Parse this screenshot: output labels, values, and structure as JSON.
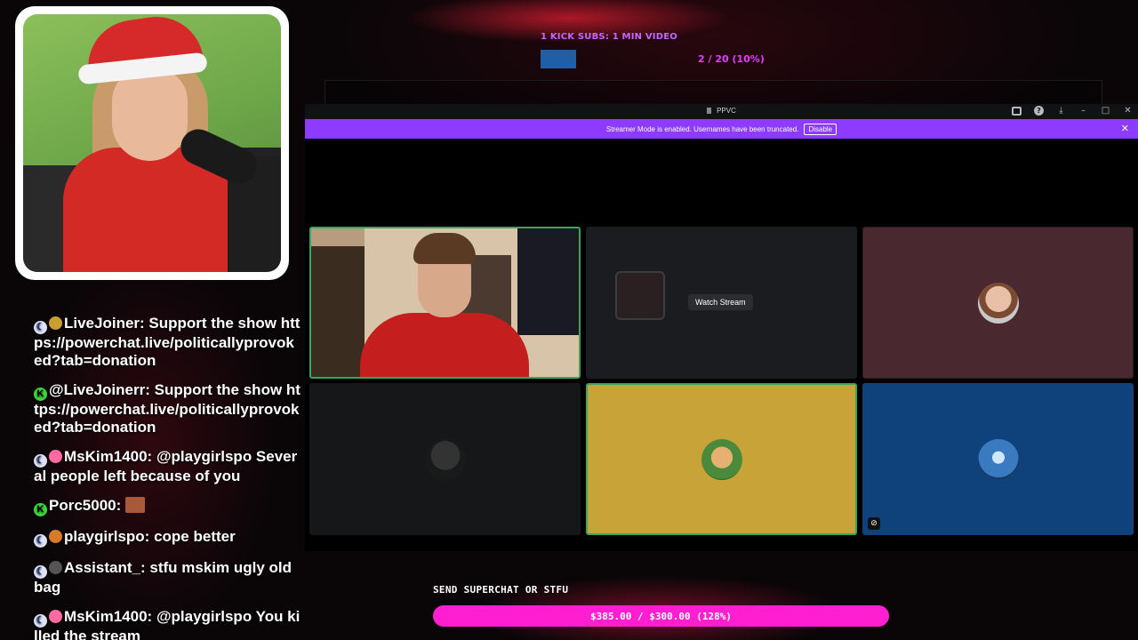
{
  "top_goal": {
    "label": "1 KICK SUBS: 1 MIN VIDEO",
    "progress": "2 / 20 (10%)",
    "fraction": 0.1
  },
  "app": {
    "title": "PPVC",
    "titlebar_icons": [
      "inbox-icon",
      "help-icon",
      "download-icon",
      "minimize-icon",
      "maximize-icon",
      "close-icon"
    ],
    "banner": {
      "text": "Streamer Mode is enabled. Usernames have been truncated.",
      "button": "Disable",
      "close": "✕"
    },
    "tiles": [
      {
        "kind": "video"
      },
      {
        "kind": "stream",
        "button": "Watch Stream"
      },
      {
        "kind": "avatar",
        "color": "#4a2830"
      },
      {
        "kind": "avatar",
        "color": "#161718"
      },
      {
        "kind": "avatar",
        "color": "#c8a438"
      },
      {
        "kind": "avatar",
        "color": "#0f427a"
      }
    ]
  },
  "chat": [
    {
      "badges": [
        "moon",
        "gold"
      ],
      "user": "LiveJoiner",
      "text": "Support the show https://powerchat.live/politicallyprovoked?tab=donation"
    },
    {
      "badges": [
        "kick"
      ],
      "user": "@LiveJoinerr",
      "text": "Support the show https://powerchat.live/politicallyprovoked?tab=donation"
    },
    {
      "badges": [
        "moon",
        "pink"
      ],
      "user": "MsKim1400",
      "text": "@playgirlspo Several people left because of you"
    },
    {
      "badges": [
        "kick"
      ],
      "user": "Porc5000",
      "text": ""
    },
    {
      "badges": [
        "moon",
        "flame"
      ],
      "user": "playgirlspo",
      "text": "cope better"
    },
    {
      "badges": [
        "moon",
        "dark"
      ],
      "user": "Assistant_",
      "text": "stfu mskim ugly old bag"
    },
    {
      "badges": [
        "moon",
        "pink"
      ],
      "user": "MsKim1400",
      "text": "@playgirlspo You killed the stream"
    }
  ],
  "superchat": {
    "label": "SEND SUPERCHAT OR STFU",
    "progress": "$385.00 / $300.00 (128%)",
    "fraction": 1.28
  }
}
